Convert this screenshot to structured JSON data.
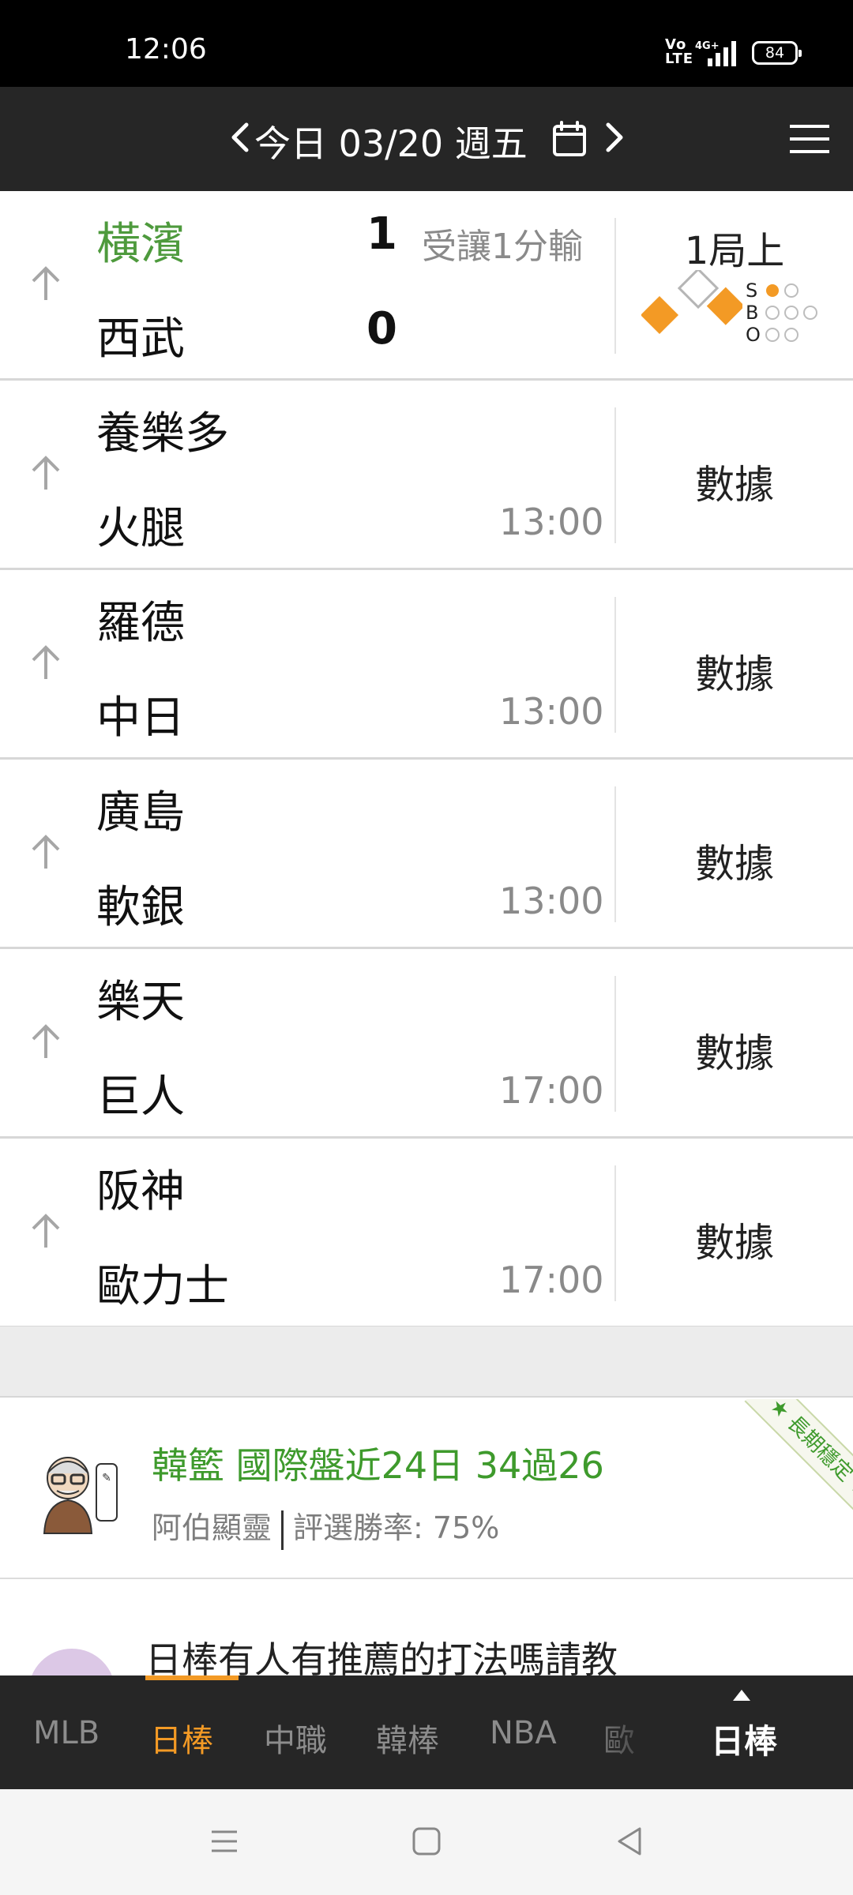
{
  "status_bar": {
    "time": "12:06",
    "network": "4G+",
    "battery": "84"
  },
  "date_header": {
    "date_text": "今日 03/20 週五",
    "prev_icon": "chevron-left-icon",
    "next_icon": "chevron-right-icon",
    "calendar_icon": "calendar-icon",
    "menu_icon": "hamburger-menu-icon"
  },
  "games": [
    {
      "away": "橫濱",
      "home": "西武",
      "away_score": "1",
      "home_score": "0",
      "note": "受讓1分輸",
      "inning": "1局上",
      "live": true,
      "count": {
        "strikes": 1,
        "balls": 0,
        "outs": 0
      },
      "sbo_labels": {
        "s": "S",
        "b": "B",
        "o": "O"
      }
    },
    {
      "away": "養樂多",
      "home": "火腿",
      "time": "13:00",
      "action": "數據"
    },
    {
      "away": "羅德",
      "home": "中日",
      "time": "13:00",
      "action": "數據"
    },
    {
      "away": "廣島",
      "home": "軟銀",
      "time": "13:00",
      "action": "數據"
    },
    {
      "away": "樂天",
      "home": "巨人",
      "time": "17:00",
      "action": "數據"
    },
    {
      "away": "阪神",
      "home": "歐力士",
      "time": "17:00",
      "action": "數據"
    }
  ],
  "expert": {
    "headline": "韓籃 國際盤近24日 34過26",
    "name": "阿伯顯靈",
    "win_rate": "評選勝率: 75%",
    "badge": "長期穩定"
  },
  "post": {
    "title": "日棒有人有推薦的打法嗎請教"
  },
  "tab_bar": {
    "tabs": [
      "MLB",
      "日棒",
      "中職",
      "韓棒",
      "NBA",
      "歐"
    ],
    "active_index": 1,
    "current": "日棒"
  },
  "colors": {
    "accent": "#f39a25",
    "live_team": "#4e9a3d",
    "expert_green": "#3e9a2c",
    "header_bg": "#262626"
  }
}
